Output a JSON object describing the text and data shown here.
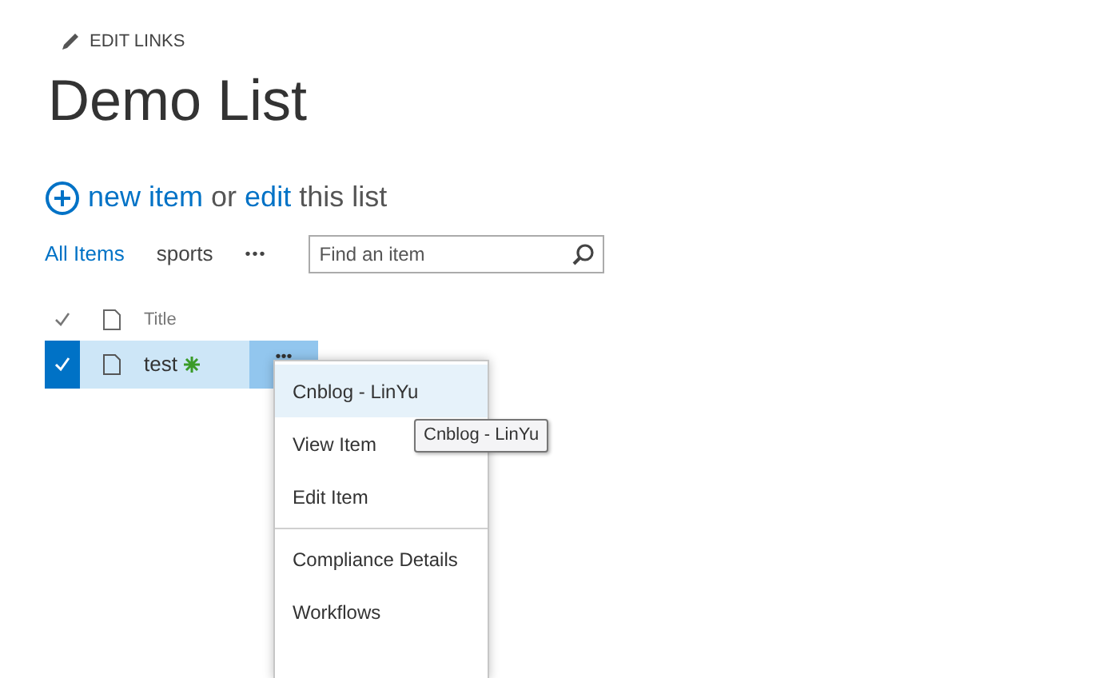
{
  "edit_links": "EDIT LINKS",
  "title": "Demo List",
  "actions": [
    {
      "text": "new item",
      "kind": "link"
    },
    {
      "text": "or",
      "kind": "plain"
    },
    {
      "text": "edit",
      "kind": "link"
    },
    {
      "text": "this list",
      "kind": "plain"
    }
  ],
  "views": [
    {
      "label": "All Items",
      "selected": true
    },
    {
      "label": "sports",
      "selected": false
    }
  ],
  "views_more": "•••",
  "search": {
    "placeholder": "Find an item"
  },
  "columns": [
    "Title"
  ],
  "rows": [
    {
      "title": "test",
      "selected": true,
      "is_new": true,
      "more": "•••"
    }
  ],
  "menu": {
    "items": [
      {
        "label": "Cnblog - LinYu",
        "hovered": true,
        "separator_before": false
      },
      {
        "label": "View Item",
        "hovered": false,
        "separator_before": false
      },
      {
        "label": "Edit Item",
        "hovered": false,
        "separator_before": false
      },
      {
        "label": "Compliance Details",
        "hovered": false,
        "separator_before": true
      },
      {
        "label": "Workflows",
        "hovered": false,
        "separator_before": false
      }
    ]
  },
  "tooltip": "Cnblog - LinYu"
}
